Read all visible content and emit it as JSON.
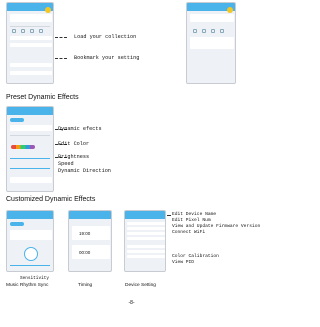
{
  "section1": {
    "callouts": {
      "load_collection": "Load your collection",
      "bookmark_setting": "Bookmark your setting"
    }
  },
  "section2": {
    "title": "Preset Dynamic Effects",
    "callouts": {
      "dynamic_efects": "Dynamic efects",
      "edit_color": "Edit Color",
      "brightness": "Brightness",
      "speed": "Speed",
      "dynamic_direction": "Dynamic Direction"
    }
  },
  "section3": {
    "title": "Customized Dynamic Effects",
    "sensitivity_label": "Sensitivity",
    "captions": {
      "music": "Music Rhythm Sync",
      "timing": "Timing",
      "device": "Device Setting"
    },
    "timing_values": [
      "19:00",
      "00:00"
    ],
    "device_callouts": {
      "edit_device_name": "Edit Device Name",
      "edit_pixel_num": "Edit Pixel Num",
      "view_update_firmware": "View and Update Firmware Version",
      "connect_wifi": "Connect WiFi",
      "color_calibration": "Color Calibration",
      "view_pid": "View PID"
    }
  },
  "page_number": "-8-",
  "colors": {
    "accent": "#4ab3ea",
    "yellow": "#f3c623",
    "frame": "#eef1f5"
  }
}
